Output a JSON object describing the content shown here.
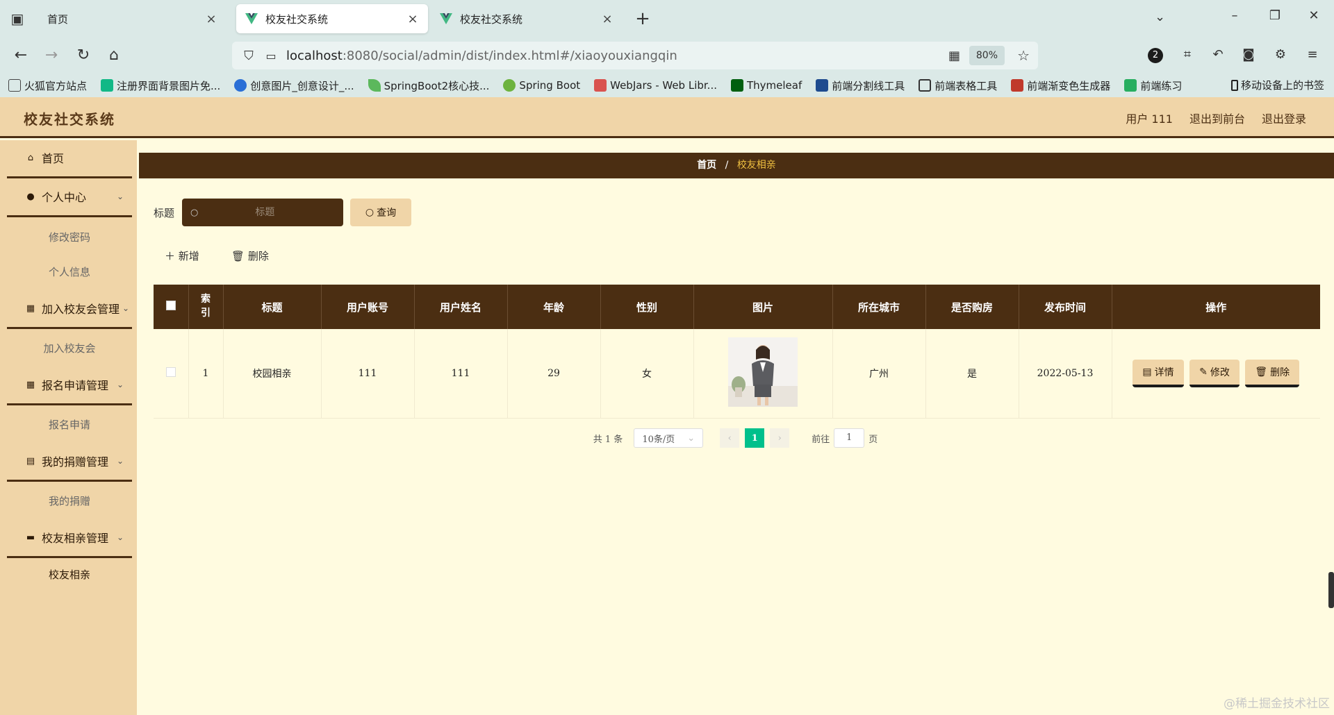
{
  "browser": {
    "tabs": [
      {
        "title": "首页",
        "active": false
      },
      {
        "title": "校友社交系统",
        "active": true
      },
      {
        "title": "校友社交系统",
        "active": false
      }
    ],
    "url_host": "localhost",
    "url_rest": ":8080/social/admin/dist/index.html#/xiaoyouxiangqin",
    "zoom": "80%",
    "badge_count": "2",
    "bookmarks": [
      {
        "label": "火狐官方站点",
        "color": "#444444"
      },
      {
        "label": "注册界面背景图片免...",
        "color": "#12b886"
      },
      {
        "label": "创意图片_创意设计_...",
        "color": "#2a6fd6"
      },
      {
        "label": "SpringBoot2核心技...",
        "color": "#5cb85c"
      },
      {
        "label": "Spring Boot",
        "color": "#6db33f"
      },
      {
        "label": "WebJars - Web Libr...",
        "color": "#d9534f"
      },
      {
        "label": "Thymeleaf",
        "color": "#005f0f"
      },
      {
        "label": "前端分割线工具",
        "color": "#1e4b8f"
      },
      {
        "label": "前端表格工具",
        "color": "#333333"
      },
      {
        "label": "前端渐变色生成器",
        "color": "#c0392b"
      },
      {
        "label": "前端练习",
        "color": "#27ae60"
      }
    ],
    "mobile_bookmarks": "移动设备上的书签"
  },
  "header": {
    "title": "校友社交系统",
    "user": "用户 111",
    "exit_front": "退出到前台",
    "logout": "退出登录"
  },
  "sidebar": {
    "home": "首页",
    "personal": "个人中心",
    "change_password": "修改密码",
    "personal_info": "个人信息",
    "join_mgmt": "加入校友会管理",
    "join": "加入校友会",
    "signup_mgmt": "报名申请管理",
    "signup": "报名申请",
    "donation_mgmt": "我的捐赠管理",
    "donation": "我的捐赠",
    "match_mgmt": "校友相亲管理",
    "match": "校友相亲"
  },
  "breadcrumb": {
    "home": "首页",
    "separator": "/",
    "current": "校友相亲"
  },
  "search": {
    "label": "标题",
    "placeholder": "标题",
    "button": "查询"
  },
  "actions": {
    "add": "新增",
    "delete": "删除"
  },
  "table": {
    "headers": [
      "索引",
      "标题",
      "用户账号",
      "用户姓名",
      "年龄",
      "性别",
      "图片",
      "所在城市",
      "是否购房",
      "发布时间",
      "操作"
    ],
    "rows": [
      {
        "index": "1",
        "title": "校园相亲",
        "account": "111",
        "name": "111",
        "age": "29",
        "gender": "女",
        "city": "广州",
        "house": "是",
        "time": "2022-05-13"
      }
    ],
    "op_detail": "详情",
    "op_edit": "修改",
    "op_delete": "删除"
  },
  "pagination": {
    "total": "共 1 条",
    "page_size": "10条/页",
    "current": "1",
    "goto_prefix": "前往",
    "goto_value": "1",
    "goto_suffix": "页"
  },
  "watermark": "@稀土掘金技术社区"
}
